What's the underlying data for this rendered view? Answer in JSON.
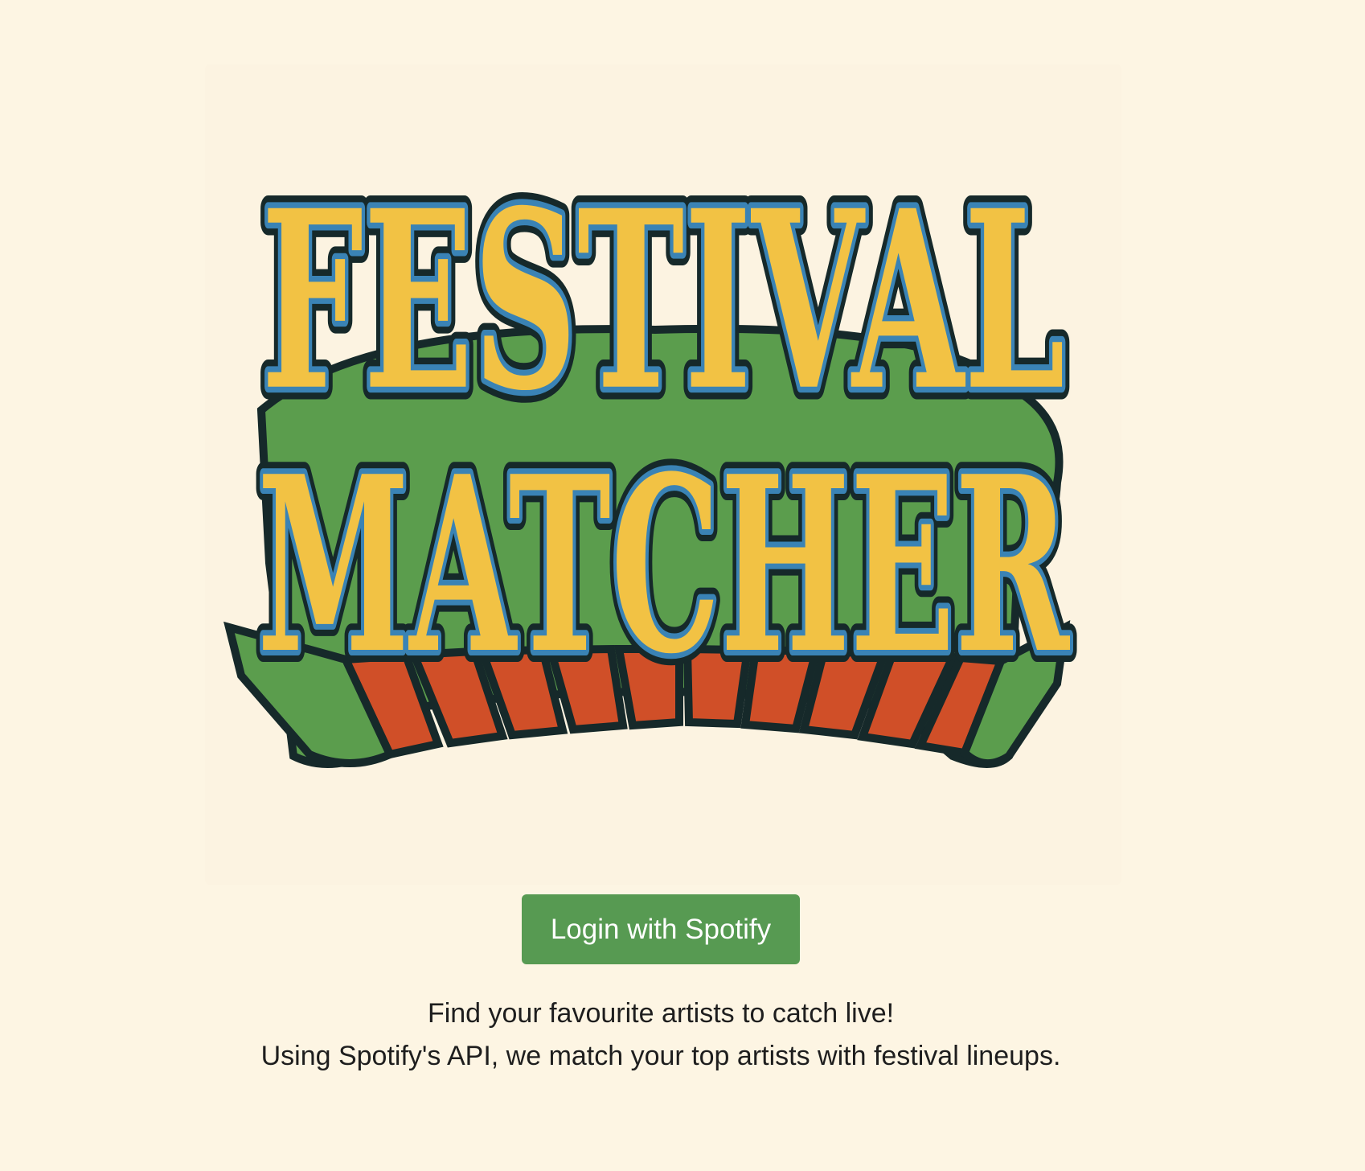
{
  "logo": {
    "line1": "FESTIVAL",
    "line2": "MATCHER",
    "colors": {
      "fill": "#f2c244",
      "stroke": "#3a83b5",
      "outline": "#16292a",
      "green": "#5b9d4d",
      "orange": "#d04f28"
    }
  },
  "login_button": {
    "label": "Login with Spotify",
    "color": "#579a52"
  },
  "description": {
    "line1": "Find your favourite artists to catch live!",
    "line2": "Using Spotify's API, we match your top artists with festival lineups."
  }
}
